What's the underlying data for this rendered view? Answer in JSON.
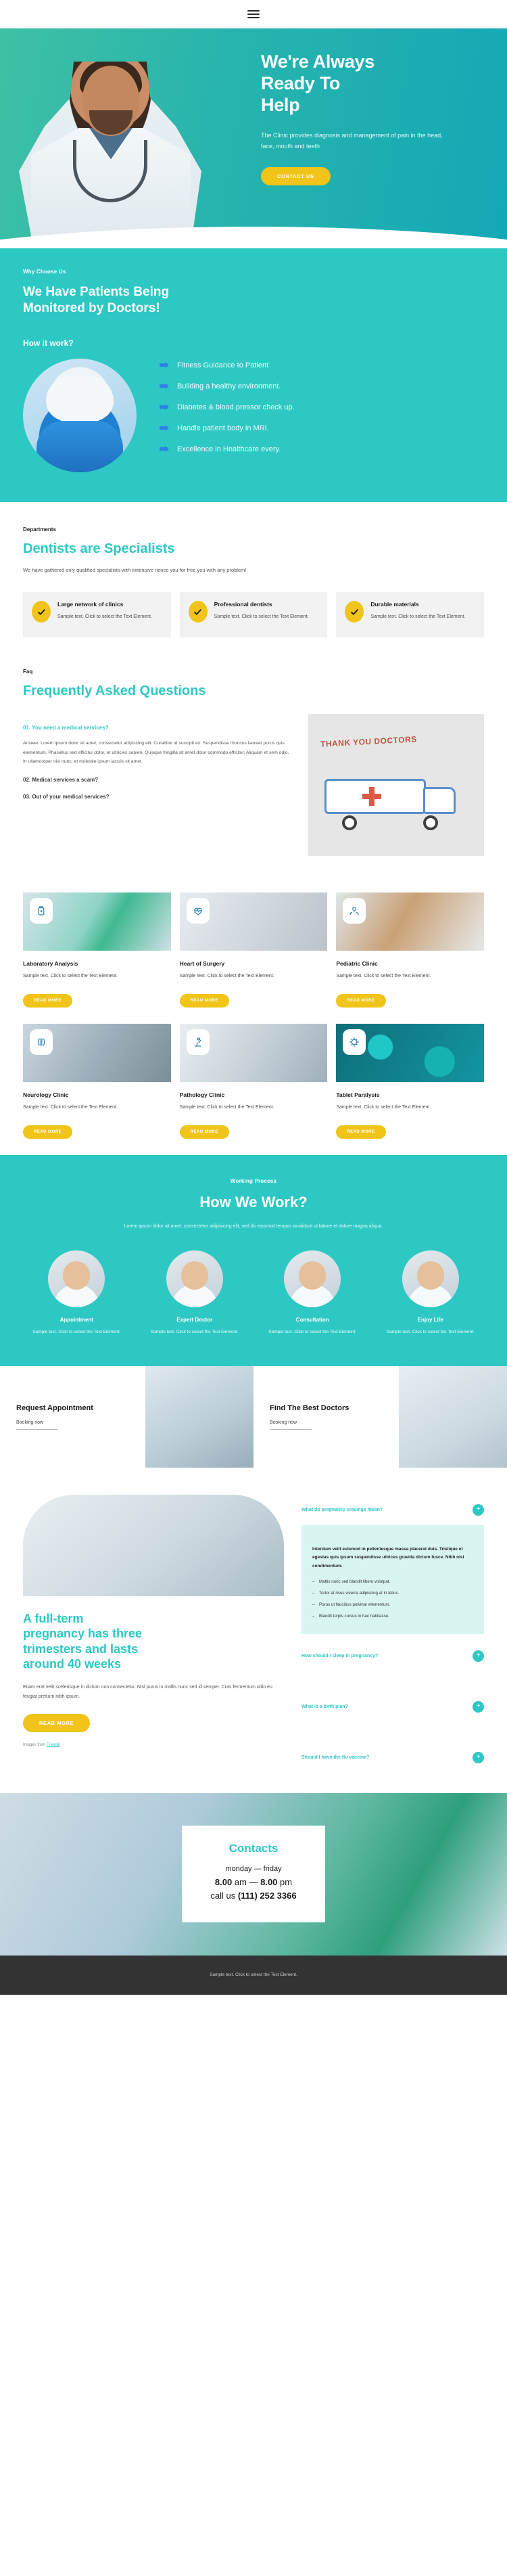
{
  "nav": {
    "menu_icon": "hamburger-menu-icon"
  },
  "hero": {
    "title_line1": "We're Always",
    "title_line2": "Ready To",
    "title_line3": "Help",
    "paragraph": "The Clinic provides diagnosis and management of pain in the head, face, mouth and teeth",
    "cta_label": "CONTACT US"
  },
  "why": {
    "eyebrow": "Why Choose Us",
    "title_line1": "We Have Patients Being",
    "title_line2": "Monitored by Doctors!",
    "subtitle": "How it work?",
    "items": [
      "Fitness Guidance to Patient",
      "Building a healthy environment.",
      "Diabetes & blood pressor check up.",
      "Handle patient body in MRI.",
      "Excellence in Healthcare every."
    ]
  },
  "departments": {
    "kicker": "Departments",
    "title": "Dentists are Specialists",
    "lead": "We have gathered only qualified specialists with extensive rience you for free you with any problem!",
    "cards": [
      {
        "title": "Large network of clinics",
        "text": "Sample text. Click to select the Text Element."
      },
      {
        "title": "Professional dentists",
        "text": "Sample text. Click to select the Text Element."
      },
      {
        "title": "Durable materials",
        "text": "Sample text. Click to select the Text Element."
      }
    ]
  },
  "faq": {
    "kicker": "Faq",
    "title": "Frequently Asked Questions",
    "items": [
      {
        "question": "01. You need a medical services?",
        "answer": "Answer. Lorem ipsum dolor sit amet, consectetur adipiscing elit. Curabitur id suscipit ex. Suspendisse rhoncus laoreet purus quis elementum. Phasellus sed efficitur dolor, et ultricies sapien. Quisque fringilla sit amet dolor commodo efficitur. Aliquam et sem odio. In ullamcorper nisi nunc, et molestie ipsum iaculis sit amet."
      },
      {
        "question": "02. Medical services a scam?",
        "answer": ""
      },
      {
        "question": "03. Out of your medical services?",
        "answer": ""
      }
    ],
    "image_note": "THANK YOU DOCTORS"
  },
  "services": {
    "row1": [
      {
        "title": "Laboratory Analysis",
        "text": "Sample text. Click to select the Text Element.",
        "button": "READ MORE",
        "icon": "medicine-bottle-icon"
      },
      {
        "title": "Heart of Surgery",
        "text": "Sample text. Click to select the Text Element.",
        "button": "READ MORE",
        "icon": "heartbeat-icon"
      },
      {
        "title": "Pediatric Clinic",
        "text": "Sample text. Click to select the Text Element.",
        "button": "READ MORE",
        "icon": "caring-hands-icon"
      }
    ],
    "row2": [
      {
        "title": "Neurology Clinic",
        "text": "Sample text. Click to select the Text Element.",
        "button": "READ MORE",
        "icon": "brain-icon"
      },
      {
        "title": "Pathology Clinic",
        "text": "Sample text. Click to select the Text Element.",
        "button": "READ MORE",
        "icon": "microscope-icon"
      },
      {
        "title": "Tablet Paralysis",
        "text": "Sample text. Click to select the Text Element.",
        "button": "READ MORE",
        "icon": "virus-icon"
      }
    ]
  },
  "work": {
    "eyebrow": "Working Process",
    "title": "How We Work?",
    "subtitle": "Lorem ipsum dolor sit amet, consectetur adipisicing elit, sed do eiusmod tempor incididunt ut labore et dolore magna aliqua.",
    "steps": [
      {
        "title": "Appointment",
        "text": "Sample text. Click to select the Text Element."
      },
      {
        "title": "Expert Doctor",
        "text": "Sample text. Click to select the Text Element."
      },
      {
        "title": "Consultation",
        "text": "Sample text. Click to select the Text Element."
      },
      {
        "title": "Enjoy Life",
        "text": "Sample text. Click to select the Text Element."
      }
    ]
  },
  "cta": {
    "left": {
      "title": "Request Appointment",
      "link": "Booking now"
    },
    "right": {
      "title": "Find The Best Doctors",
      "link": "Booking now"
    }
  },
  "pregnancy": {
    "title_line1": "A full-term",
    "title_line2": "pregnancy has three",
    "title_line3": "trimesters and lasts",
    "title_line4": "around 40 weeks",
    "paragraph": "Etiam erat velit scelerisque in dictum non consectetur. Nisl purus in mollis nunc sed id semper. Cras fermentum odio eu feugiat pretium nibh ipsum.",
    "button": "READ MORE",
    "credit_prefix": "Images from ",
    "credit_link": "Freepik",
    "accordion": [
      {
        "question": "What do pregnancy cravings mean?",
        "open": true,
        "body": "Interdum velit euismod in pellentesque massa placerat duis. Tristique et egestas quis ipsum suspendisse ultrices gravida dictum fusce. Nibh nisl condimentum.",
        "bullets": [
          "Mattis nunc sed blandit libero volutpat.",
          "Tortor at risus viverra adipiscing at in tellus.",
          "Purus ut faucibus pulvinar elementum.",
          "Blandit turpis cursus in hac habitasse."
        ]
      },
      {
        "question": "How should I sleep in pregnancy?",
        "open": false
      },
      {
        "question": "What is a birth plan?",
        "open": false
      },
      {
        "question": "Should I have the flu vaccine?",
        "open": false
      }
    ]
  },
  "contacts": {
    "title": "Contacts",
    "days": "monday — friday",
    "hours_bold_1": "8.00",
    "hours_mid_1": " am — ",
    "hours_bold_2": "8.00",
    "hours_mid_2": " pm",
    "call_prefix": "call us ",
    "phone": "(111) 252 3366"
  },
  "footer": {
    "text": "Sample text. Click to select the Text Element."
  },
  "colors": {
    "teal": "#2ec8c4",
    "yellow": "#f0c419",
    "dark": "#333333",
    "blue_arrow": "#2e7fe8"
  }
}
